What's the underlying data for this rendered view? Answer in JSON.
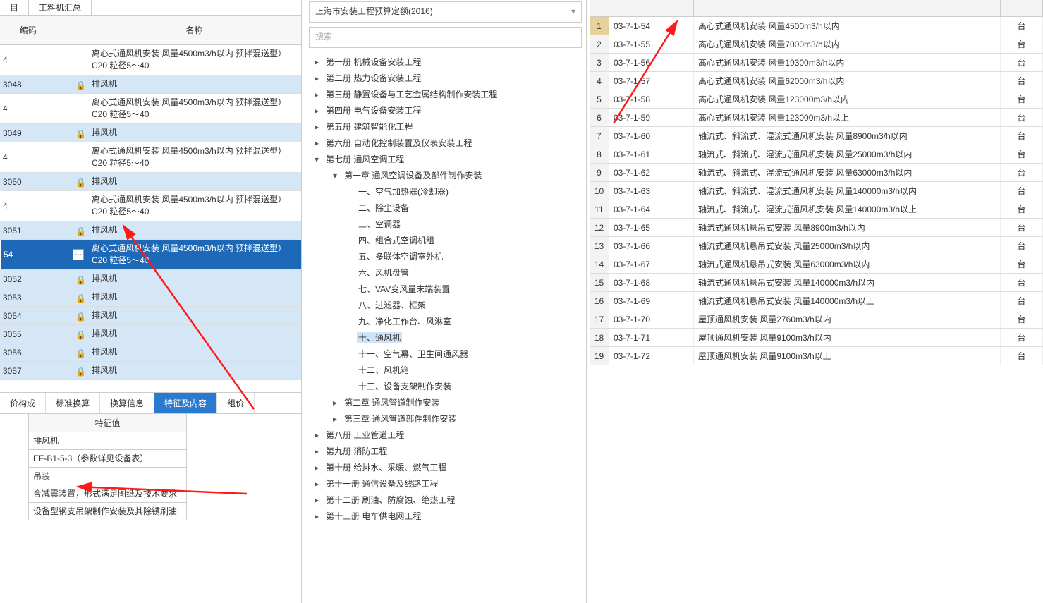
{
  "top_tabs": [
    "目",
    "工料机汇总"
  ],
  "left_header": {
    "c1": "编码",
    "c2": "名称"
  },
  "left_rows": [
    {
      "code": "4",
      "name": "离心式通风机安装 风量4500m3/h以内 预拌混送型）C20 粒径5～40",
      "blue": false,
      "lock": false
    },
    {
      "code": "3048",
      "name": "排风机",
      "blue": true,
      "lock": true
    },
    {
      "code": "4",
      "name": "离心式通风机安装 风量4500m3/h以内 预拌混送型）C20 粒径5～40",
      "blue": false,
      "lock": false
    },
    {
      "code": "3049",
      "name": "排风机",
      "blue": true,
      "lock": true
    },
    {
      "code": "4",
      "name": "离心式通风机安装 风量4500m3/h以内 预拌混送型）C20 粒径5～40",
      "blue": false,
      "lock": false
    },
    {
      "code": "3050",
      "name": "排风机",
      "blue": true,
      "lock": true
    },
    {
      "code": "4",
      "name": "离心式通风机安装 风量4500m3/h以内 预拌混送型）C20 粒径5～40",
      "blue": false,
      "lock": false
    },
    {
      "code": "3051",
      "name": "排风机",
      "blue": true,
      "lock": true
    },
    {
      "code": "54",
      "name": "离心式通风机安装 风量4500m3/h以内 预拌混送型）C20 粒径5～40",
      "blue": false,
      "lock": false,
      "sel": true,
      "btn": true
    },
    {
      "code": "3052",
      "name": "排风机",
      "blue": true,
      "lock": true
    },
    {
      "code": "3053",
      "name": "排风机",
      "blue": true,
      "lock": true
    },
    {
      "code": "3054",
      "name": "排风机",
      "blue": true,
      "lock": true
    },
    {
      "code": "3055",
      "name": "排风机",
      "blue": true,
      "lock": true
    },
    {
      "code": "3056",
      "name": "排风机",
      "blue": true,
      "lock": true
    },
    {
      "code": "3057",
      "name": "排风机",
      "blue": true,
      "lock": true
    }
  ],
  "bottom_tabs": [
    "价构成",
    "标准换算",
    "换算信息",
    "特征及内容",
    "组价"
  ],
  "bottom_active": 3,
  "feature_header": "特征值",
  "features": [
    "排风机",
    "EF-B1-5-3（参数详见设备表）",
    "吊装",
    "含减震装置，形式满足图纸及技术要求",
    "设备型钢支吊架制作安装及其除锈刷油"
  ],
  "mid_title": "上海市安装工程预算定额(2016)",
  "search_placeholder": "搜索",
  "tree": [
    {
      "t": "▸",
      "l": "第一册 机械设备安装工程",
      "d": 0
    },
    {
      "t": "▸",
      "l": "第二册 热力设备安装工程",
      "d": 0
    },
    {
      "t": "▸",
      "l": "第三册 静置设备与工艺金属结构制作安装工程",
      "d": 0
    },
    {
      "t": "▸",
      "l": "第四册 电气设备安装工程",
      "d": 0
    },
    {
      "t": "▸",
      "l": "第五册 建筑智能化工程",
      "d": 0
    },
    {
      "t": "▸",
      "l": "第六册 自动化控制装置及仪表安装工程",
      "d": 0
    },
    {
      "t": "▾",
      "l": "第七册 通风空调工程",
      "d": 0
    },
    {
      "t": "▾",
      "l": "第一章 通风空调设备及部件制作安装",
      "d": 1
    },
    {
      "t": "",
      "l": "一、空气加热器(冷却器)",
      "d": 2
    },
    {
      "t": "",
      "l": "二、除尘设备",
      "d": 2
    },
    {
      "t": "",
      "l": "三、空调器",
      "d": 2
    },
    {
      "t": "",
      "l": "四、组合式空调机组",
      "d": 2
    },
    {
      "t": "",
      "l": "五、多联体空调室外机",
      "d": 2
    },
    {
      "t": "",
      "l": "六、风机盘管",
      "d": 2
    },
    {
      "t": "",
      "l": "七、VAV变风量末端装置",
      "d": 2
    },
    {
      "t": "",
      "l": "八、过滤器、框架",
      "d": 2
    },
    {
      "t": "",
      "l": "九、净化工作台、风淋室",
      "d": 2
    },
    {
      "t": "",
      "l": "十、通风机",
      "d": 2,
      "sel": true
    },
    {
      "t": "",
      "l": "十一、空气幕、卫生间通风器",
      "d": 2
    },
    {
      "t": "",
      "l": "十二、风机箱",
      "d": 2
    },
    {
      "t": "",
      "l": "十三、设备支架制作安装",
      "d": 2
    },
    {
      "t": "▸",
      "l": "第二章 通风管道制作安装",
      "d": 1
    },
    {
      "t": "▸",
      "l": "第三章 通风管道部件制作安装",
      "d": 1
    },
    {
      "t": "▸",
      "l": "第八册 工业管道工程",
      "d": 0
    },
    {
      "t": "▸",
      "l": "第九册 消防工程",
      "d": 0
    },
    {
      "t": "▸",
      "l": "第十册 给排水、采暖、燃气工程",
      "d": 0
    },
    {
      "t": "▸",
      "l": "第十一册 通信设备及线路工程",
      "d": 0
    },
    {
      "t": "▸",
      "l": "第十二册 刷油、防腐蚀、绝热工程",
      "d": 0
    },
    {
      "t": "▸",
      "l": "第十三册 电车供电网工程",
      "d": 0
    }
  ],
  "right_rows": [
    {
      "n": "1",
      "c": "03-7-1-54",
      "name": "离心式通风机安装 风量4500m3/h以内",
      "u": "台",
      "sel": true
    },
    {
      "n": "2",
      "c": "03-7-1-55",
      "name": "离心式通风机安装 风量7000m3/h以内",
      "u": "台"
    },
    {
      "n": "3",
      "c": "03-7-1-56",
      "name": "离心式通风机安装 风量19300m3/h以内",
      "u": "台"
    },
    {
      "n": "4",
      "c": "03-7-1-57",
      "name": "离心式通风机安装 风量62000m3/h以内",
      "u": "台"
    },
    {
      "n": "5",
      "c": "03-7-1-58",
      "name": "离心式通风机安装 风量123000m3/h以内",
      "u": "台"
    },
    {
      "n": "6",
      "c": "03-7-1-59",
      "name": "离心式通风机安装 风量123000m3/h以上",
      "u": "台"
    },
    {
      "n": "7",
      "c": "03-7-1-60",
      "name": "轴流式、斜流式、混流式通风机安装 风量8900m3/h以内",
      "u": "台"
    },
    {
      "n": "8",
      "c": "03-7-1-61",
      "name": "轴流式、斜流式、混流式通风机安装 风量25000m3/h以内",
      "u": "台"
    },
    {
      "n": "9",
      "c": "03-7-1-62",
      "name": "轴流式、斜流式、混流式通风机安装 风量63000m3/h以内",
      "u": "台"
    },
    {
      "n": "10",
      "c": "03-7-1-63",
      "name": "轴流式、斜流式、混流式通风机安装 风量140000m3/h以内",
      "u": "台"
    },
    {
      "n": "11",
      "c": "03-7-1-64",
      "name": "轴流式、斜流式、混流式通风机安装 风量140000m3/h以上",
      "u": "台"
    },
    {
      "n": "12",
      "c": "03-7-1-65",
      "name": "轴流式通风机悬吊式安装 风量8900m3/h以内",
      "u": "台"
    },
    {
      "n": "13",
      "c": "03-7-1-66",
      "name": "轴流式通风机悬吊式安装 风量25000m3/h以内",
      "u": "台"
    },
    {
      "n": "14",
      "c": "03-7-1-67",
      "name": "轴流式通风机悬吊式安装 风量63000m3/h以内",
      "u": "台"
    },
    {
      "n": "15",
      "c": "03-7-1-68",
      "name": "轴流式通风机悬吊式安装 风量140000m3/h以内",
      "u": "台"
    },
    {
      "n": "16",
      "c": "03-7-1-69",
      "name": "轴流式通风机悬吊式安装 风量140000m3/h以上",
      "u": "台"
    },
    {
      "n": "17",
      "c": "03-7-1-70",
      "name": "屋顶通风机安装 风量2760m3/h以内",
      "u": "台"
    },
    {
      "n": "18",
      "c": "03-7-1-71",
      "name": "屋顶通风机安装 风量9100m3/h以内",
      "u": "台"
    },
    {
      "n": "19",
      "c": "03-7-1-72",
      "name": "屋顶通风机安装 风量9100m3/h以上",
      "u": "台"
    }
  ]
}
